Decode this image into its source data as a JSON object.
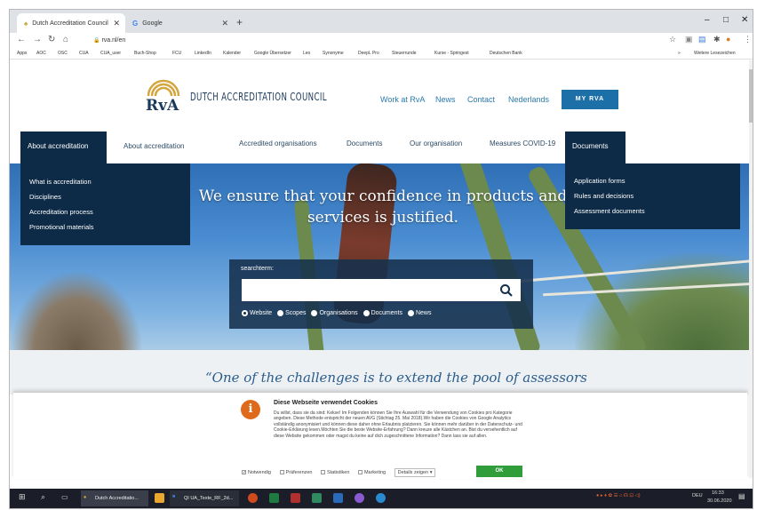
{
  "browser": {
    "tabs": [
      {
        "label": "Dutch Accreditation Council",
        "active": true
      },
      {
        "label": "Google",
        "active": false
      }
    ],
    "new_tab": "+",
    "window_controls": [
      "–",
      "□",
      "✕"
    ],
    "url": "rva.nl/en",
    "bookmarks": [
      "Apps",
      "AOC",
      "OSC",
      "CUA",
      "CUA_user",
      "Buch-Shop",
      "FCU",
      "LinkedIn",
      "Kalender",
      "Google Übersetzer",
      "Leo",
      "Synonyme",
      "DeepL Pro",
      "Steuerrunde",
      "Kurse - Springest",
      "Deutschen Bank",
      "»",
      "Weitere Lesezeichen"
    ]
  },
  "site": {
    "logo_text": "DUTCH ACCREDITATION COUNCIL",
    "top_nav": [
      "Work at RvA",
      "News",
      "Contact",
      "Nederlands"
    ],
    "my_rva": "MY RVA",
    "main_nav": {
      "active_left": "About accreditation",
      "items": [
        "About accreditation",
        "Accredited organisations",
        "Documents",
        "Our organisation",
        "Measures COVID-19"
      ],
      "active_right": "Documents"
    },
    "dropdown_left": [
      "What is accreditation",
      "Disciplines",
      "Accreditation process",
      "Promotional materials"
    ],
    "dropdown_right": [
      "Application forms",
      "Rules and decisions",
      "Assessment documents"
    ],
    "hero_text": "We ensure that your confidence in products and services is justified.",
    "search": {
      "label": "searchterm:",
      "placeholder": "",
      "options": [
        "Website",
        "Scopes",
        "Organisations",
        "Documents",
        "News"
      ],
      "selected": "Website"
    },
    "quote": "“One of the challenges is to extend the pool of assessors"
  },
  "cookie": {
    "title": "Diese Webseite verwendet Cookies",
    "body": "Du willst, dass sie da sind: Kekse! Im Folgenden können Sie Ihre Auswahl für die Verwendung von Cookies pro Kategorie angeben. Diese Methode entspricht der neuen AVG (Stichtag 25. Mai 2018).Wir haben die Cookies von Google Analytics vollständig anonymisiert und können diese daher ohne Erlaubnis platzieren. Sie können mehr darüber in der Datenschutz- und Cookie-Erklärung lesen.Möchten Sie die beste Website-Erfahrung? Dann kreuze alle Kästchen an. Bist du versehentlich auf diese Website gekommen oder magst du keine auf dich zugeschnittene Information? Dann lass sie auf allen.",
    "options": [
      "Notwendig",
      "Präferenzen",
      "Statistiken",
      "Marketing"
    ],
    "details": "Details zeigen ▾",
    "ok": "OK"
  },
  "taskbar": {
    "apps": [
      "Dutch Accreditatio...",
      "QI UA_Texte_RF_2d..."
    ],
    "lang": "DEU",
    "time": "16:33",
    "date": "30.06.2020"
  },
  "colors": {
    "navy": "#0d2b46",
    "accent": "#1d6fa8",
    "link": "#2a7ab0",
    "ok": "#2f9e3a",
    "cookie_icon": "#e06a1c"
  }
}
